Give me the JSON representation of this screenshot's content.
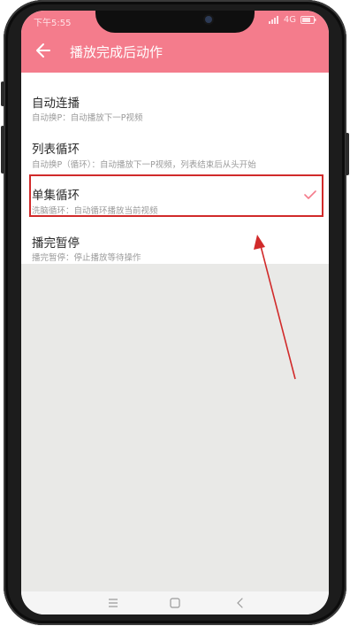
{
  "status_bar": {
    "time": "下午5:55",
    "network": "4G"
  },
  "header": {
    "title": "播放完成后动作",
    "back_icon": "arrow-left-icon",
    "background_color": "#f47c8c"
  },
  "options": [
    {
      "title": "自动连播",
      "subtitle": "自动换P：自动播放下一P视频",
      "selected": false
    },
    {
      "title": "列表循环",
      "subtitle": "自动换P（循环）：自动播放下一P视频，列表结束后从头开始",
      "selected": false
    },
    {
      "title": "单集循环",
      "subtitle": "洗脑循环：自动循环播放当前视频",
      "selected": true
    },
    {
      "title": "播完暂停",
      "subtitle": "播完暂停：停止播放等待操作",
      "selected": false
    }
  ],
  "annotation": {
    "highlight_color": "#d12a2a"
  },
  "navbar": {
    "icons": [
      "menu-icon",
      "home-icon",
      "back-icon"
    ]
  }
}
